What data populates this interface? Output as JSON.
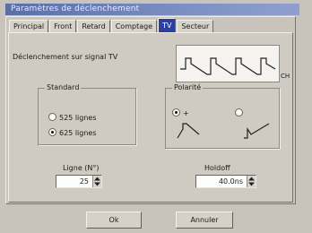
{
  "window": {
    "title": "Paramètres de déclenchement"
  },
  "tabs": [
    {
      "label": "Principal"
    },
    {
      "label": "Front"
    },
    {
      "label": "Retard"
    },
    {
      "label": "Comptage"
    },
    {
      "label": "TV",
      "active": true
    },
    {
      "label": "Secteur"
    }
  ],
  "trigger": {
    "label": "Déclenchement sur signal TV",
    "preview_tag": "CH"
  },
  "standard": {
    "title": "Standard",
    "options": [
      {
        "label": "525 lignes",
        "selected": false
      },
      {
        "label": "625 lignes",
        "selected": true
      }
    ]
  },
  "polarity": {
    "title": "Polarité",
    "options": [
      {
        "label": "+",
        "selected": true
      },
      {
        "label": "",
        "selected": false
      }
    ]
  },
  "line": {
    "label": "Ligne (N°)",
    "value": "25"
  },
  "holdoff": {
    "label": "Holdoff",
    "value": "40.0ns"
  },
  "buttons": {
    "ok": "Ok",
    "cancel": "Annuler"
  },
  "colors": {
    "active_tab": "#2a3fa0",
    "title_bar": "#5a6fa8"
  }
}
